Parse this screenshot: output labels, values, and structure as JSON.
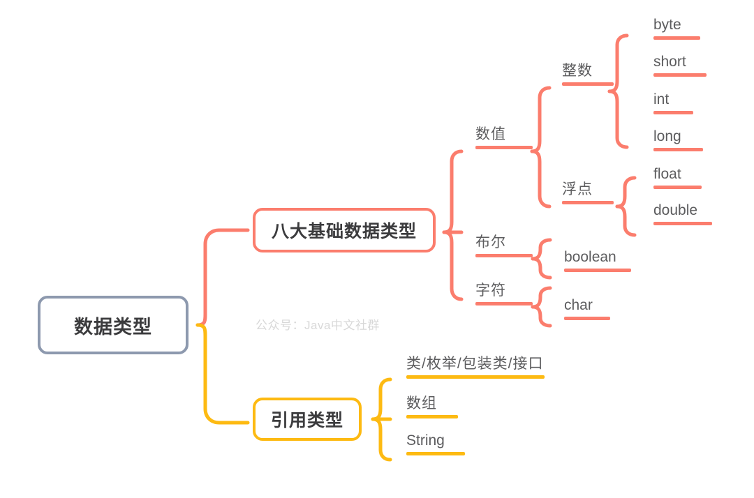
{
  "diagram": {
    "type": "mindmap",
    "title": "数据类型",
    "watermark": "公众号：Java中文社群",
    "colors": {
      "root_border": "#8d99ae",
      "primitive_branch": "#fb7d6d",
      "reference_branch": "#fdba12",
      "text": "#5c5c5e",
      "background": "#ffffff"
    },
    "root": {
      "label": "数据类型"
    },
    "branches": [
      {
        "label": "八大基础数据类型",
        "color": "#fb7d6d",
        "children": [
          {
            "label": "数值",
            "children": [
              {
                "label": "整数",
                "children": [
                  {
                    "label": "byte"
                  },
                  {
                    "label": "short"
                  },
                  {
                    "label": "int"
                  },
                  {
                    "label": "long"
                  }
                ]
              },
              {
                "label": "浮点",
                "children": [
                  {
                    "label": "float"
                  },
                  {
                    "label": "double"
                  }
                ]
              }
            ]
          },
          {
            "label": "布尔",
            "children": [
              {
                "label": "boolean"
              }
            ]
          },
          {
            "label": "字符",
            "children": [
              {
                "label": "char"
              }
            ]
          }
        ]
      },
      {
        "label": "引用类型",
        "color": "#fdba12",
        "children": [
          {
            "label": "类/枚举/包装类/接口"
          },
          {
            "label": "数组"
          },
          {
            "label": "String"
          }
        ]
      }
    ]
  },
  "labels": {
    "root": "数据类型",
    "primitive": "八大基础数据类型",
    "reference": "引用类型",
    "numeric": "数值",
    "integer": "整数",
    "floating": "浮点",
    "boolean_cn": "布尔",
    "char_cn": "字符",
    "byte": "byte",
    "short": "short",
    "int": "int",
    "long": "long",
    "float": "float",
    "double": "double",
    "boolean": "boolean",
    "char": "char",
    "ref_class": "类/枚举/包装类/接口",
    "ref_array": "数组",
    "ref_string": "String",
    "watermark": "公众号：Java中文社群"
  }
}
